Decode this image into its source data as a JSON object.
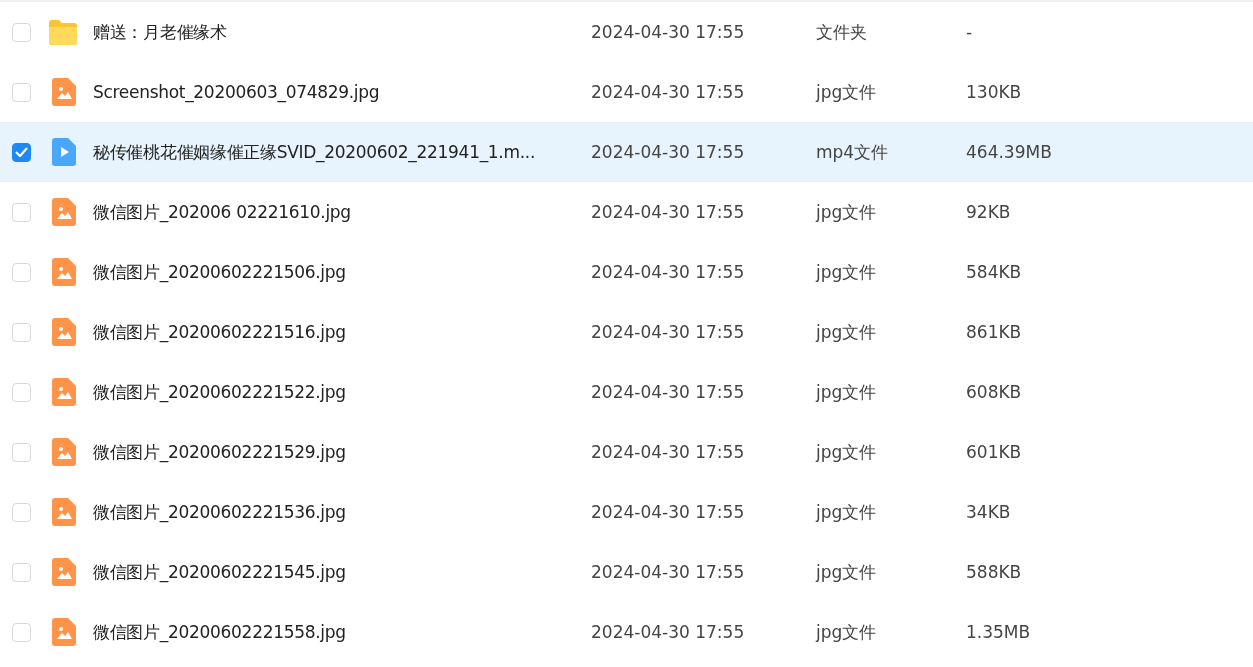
{
  "files": [
    {
      "kind": "folder",
      "name": "赠送：月老催缘术",
      "modified": "2024-04-30 17:55",
      "type": "文件夹",
      "size": "-",
      "selected": false
    },
    {
      "kind": "image",
      "name": "Screenshot_20200603_074829.jpg",
      "modified": "2024-04-30 17:55",
      "type": "jpg文件",
      "size": "130KB",
      "selected": false
    },
    {
      "kind": "video",
      "name": "秘传催桃花催姻缘催正缘SVID_20200602_221941_1.m...",
      "modified": "2024-04-30 17:55",
      "type": "mp4文件",
      "size": "464.39MB",
      "selected": true
    },
    {
      "kind": "image",
      "name": "微信图片_202006 02221610.jpg",
      "modified": "2024-04-30 17:55",
      "type": "jpg文件",
      "size": "92KB",
      "selected": false
    },
    {
      "kind": "image",
      "name": "微信图片_20200602221506.jpg",
      "modified": "2024-04-30 17:55",
      "type": "jpg文件",
      "size": "584KB",
      "selected": false
    },
    {
      "kind": "image",
      "name": "微信图片_20200602221516.jpg",
      "modified": "2024-04-30 17:55",
      "type": "jpg文件",
      "size": "861KB",
      "selected": false
    },
    {
      "kind": "image",
      "name": "微信图片_20200602221522.jpg",
      "modified": "2024-04-30 17:55",
      "type": "jpg文件",
      "size": "608KB",
      "selected": false
    },
    {
      "kind": "image",
      "name": "微信图片_20200602221529.jpg",
      "modified": "2024-04-30 17:55",
      "type": "jpg文件",
      "size": "601KB",
      "selected": false
    },
    {
      "kind": "image",
      "name": "微信图片_20200602221536.jpg",
      "modified": "2024-04-30 17:55",
      "type": "jpg文件",
      "size": "34KB",
      "selected": false
    },
    {
      "kind": "image",
      "name": "微信图片_20200602221545.jpg",
      "modified": "2024-04-30 17:55",
      "type": "jpg文件",
      "size": "588KB",
      "selected": false
    },
    {
      "kind": "image",
      "name": "微信图片_20200602221558.jpg",
      "modified": "2024-04-30 17:55",
      "type": "jpg文件",
      "size": "1.35MB",
      "selected": false
    }
  ]
}
